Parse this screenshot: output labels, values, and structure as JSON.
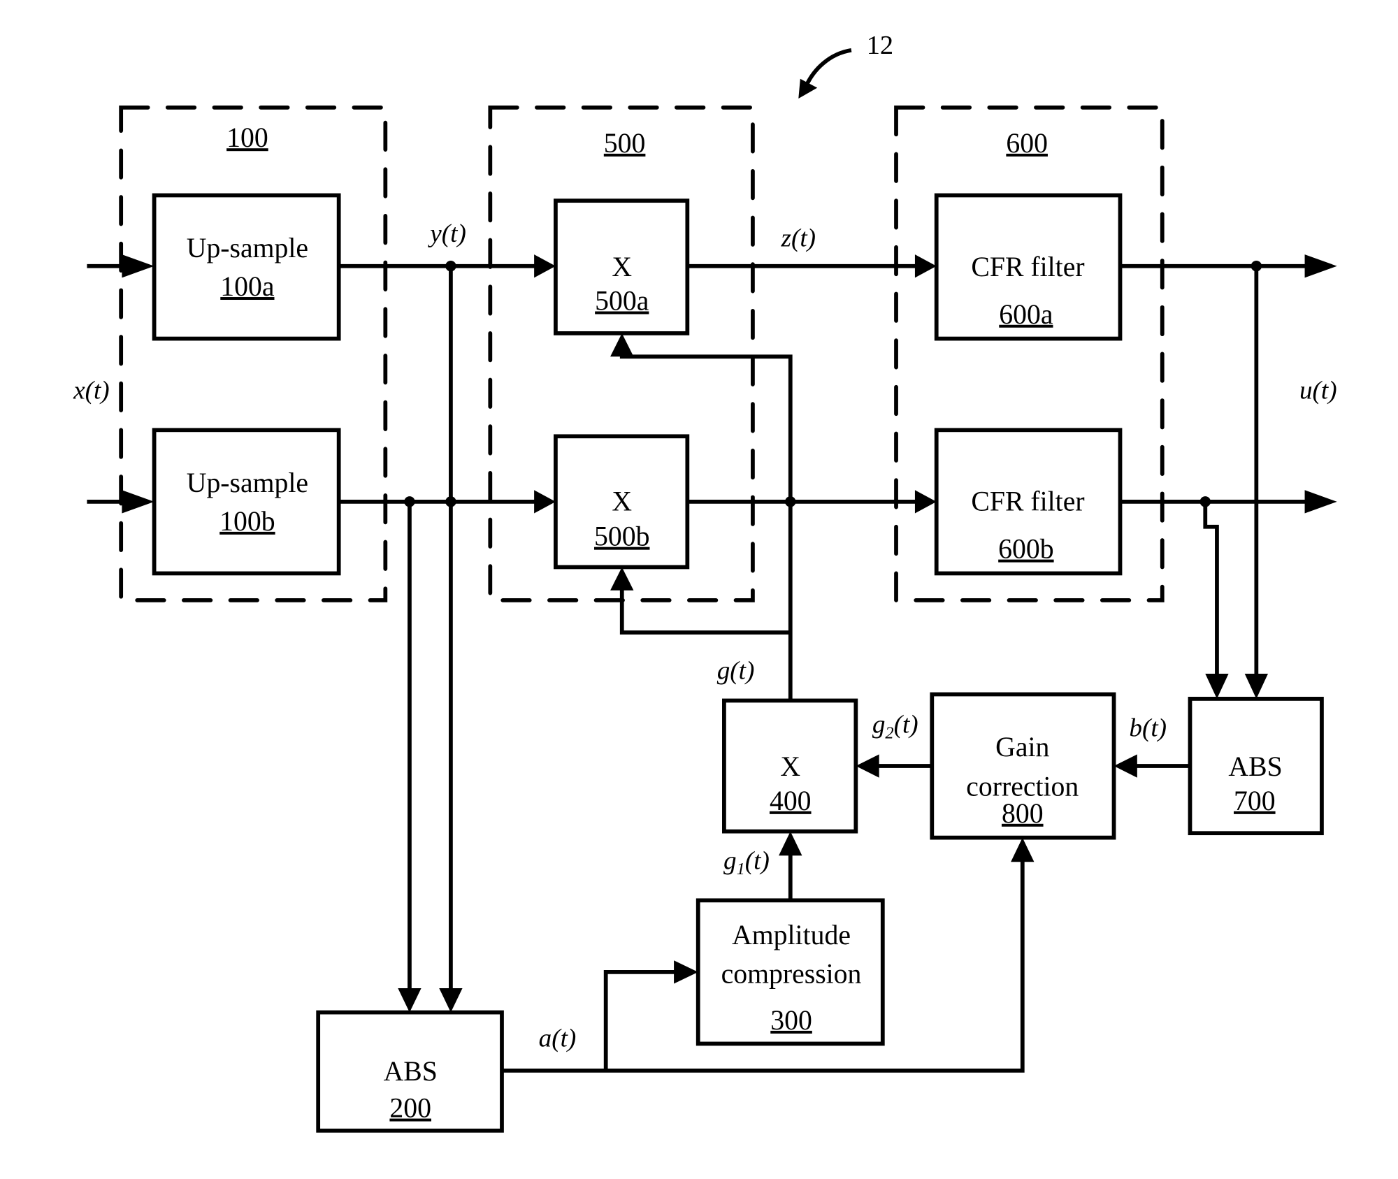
{
  "figure": {
    "reference_number": "12",
    "groups": [
      {
        "id": "100",
        "label": "100"
      },
      {
        "id": "500",
        "label": "500"
      },
      {
        "id": "600",
        "label": "600"
      }
    ],
    "blocks": {
      "upsample_a": {
        "title": "Up-sample",
        "ref": "100a"
      },
      "upsample_b": {
        "title": "Up-sample",
        "ref": "100b"
      },
      "mult_a": {
        "title": "X",
        "ref": "500a"
      },
      "mult_b": {
        "title": "X",
        "ref": "500b"
      },
      "cfr_a": {
        "title": "CFR filter",
        "ref": "600a"
      },
      "cfr_b": {
        "title": "CFR filter",
        "ref": "600b"
      },
      "abs_700": {
        "title": "ABS",
        "ref": "700"
      },
      "gain_correction": {
        "title_line1": "Gain",
        "title_line2": "correction",
        "ref": "800"
      },
      "mult_400": {
        "title": "X",
        "ref": "400"
      },
      "amplitude_compression": {
        "title_line1": "Amplitude",
        "title_line2": "compression",
        "ref": "300"
      },
      "abs_200": {
        "title": "ABS",
        "ref": "200"
      }
    },
    "signals": {
      "x": "x(t)",
      "y": "y(t)",
      "z": "z(t)",
      "u": "u(t)",
      "g": "g(t)",
      "g1_base": "g",
      "g1_sub": "1",
      "g1_tail": "(t)",
      "g2_base": "g",
      "g2_sub": "2",
      "g2_tail": "(t)",
      "b": "b(t)",
      "a": "a(t)"
    }
  }
}
